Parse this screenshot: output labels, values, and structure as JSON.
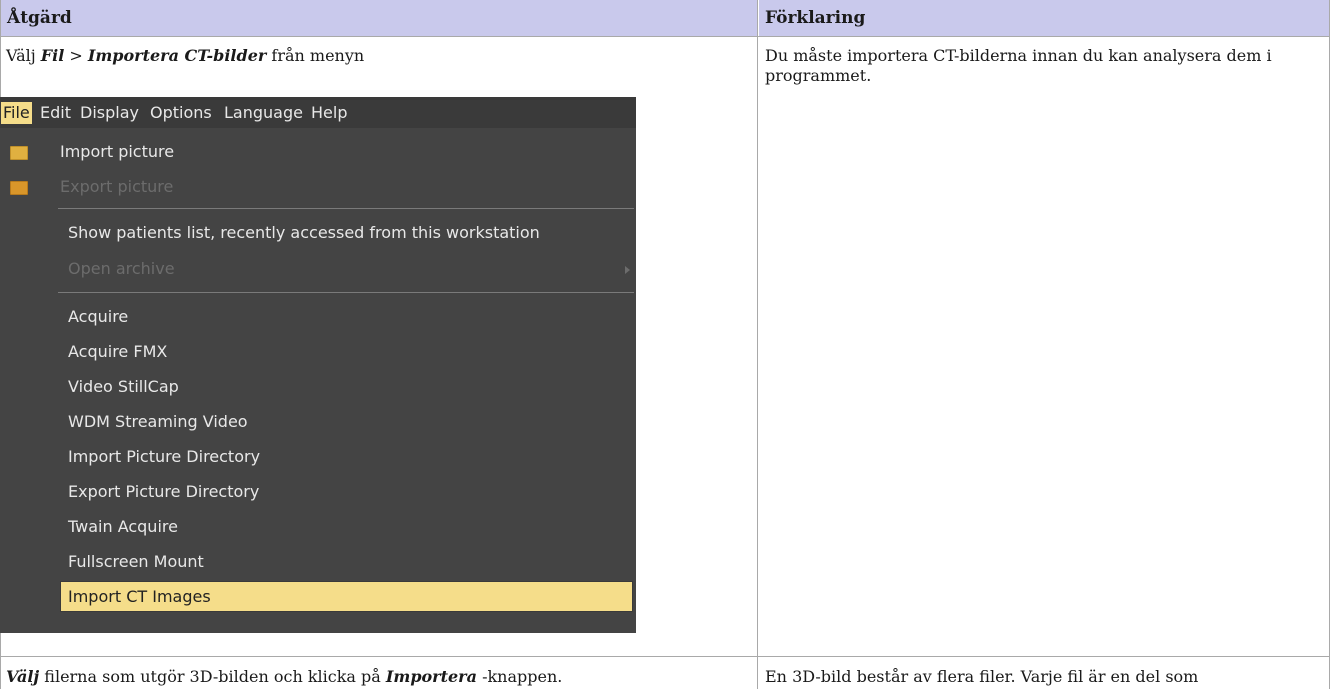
{
  "headers": {
    "action": "Åtgärd",
    "explanation": "Förklaring"
  },
  "row1": {
    "action": {
      "prefix": "Välj ",
      "bold1": "Fil",
      "sep": " > ",
      "bold2": "Importera CT-bilder",
      "suffix": " från menyn"
    },
    "explanation": "Du måste importera CT-bilderna innan du kan analysera dem i programmet."
  },
  "menu": {
    "bar": [
      "File",
      "Edit",
      "Display",
      "Options",
      "Language",
      "Help"
    ],
    "items": [
      {
        "label": "Import picture",
        "icon": "import-picture-icon"
      },
      {
        "label": "Export picture",
        "icon": "export-picture-icon",
        "disabled": true
      },
      {
        "label": "Show patients list, recently accessed from this workstation"
      },
      {
        "label": "Open archive",
        "disabled": true,
        "submenu": true
      },
      {
        "label": "Acquire"
      },
      {
        "label": "Acquire FMX"
      },
      {
        "label": "Video StillCap"
      },
      {
        "label": "WDM Streaming Video"
      },
      {
        "label": "Import Picture Directory"
      },
      {
        "label": "Export Picture Directory"
      },
      {
        "label": "Twain Acquire"
      },
      {
        "label": "Fullscreen Mount"
      },
      {
        "label": "Import CT Images",
        "highlighted": true
      }
    ],
    "colors": {
      "background": "#444444",
      "highlight": "#f5dd8a",
      "text": "#e6e6e6",
      "disabled": "#6c6c6c"
    }
  },
  "row2": {
    "action": {
      "bold1": "Välj",
      "mid": " filerna som utgör 3D-bilden och klicka på ",
      "bold2": "Importera",
      "suffix": " -knappen."
    },
    "explanation": "En 3D-bild består av flera filer. Varje fil är en del som"
  },
  "colors": {
    "header_bg": "#c9c9ec",
    "border": "#a9a9a9"
  }
}
